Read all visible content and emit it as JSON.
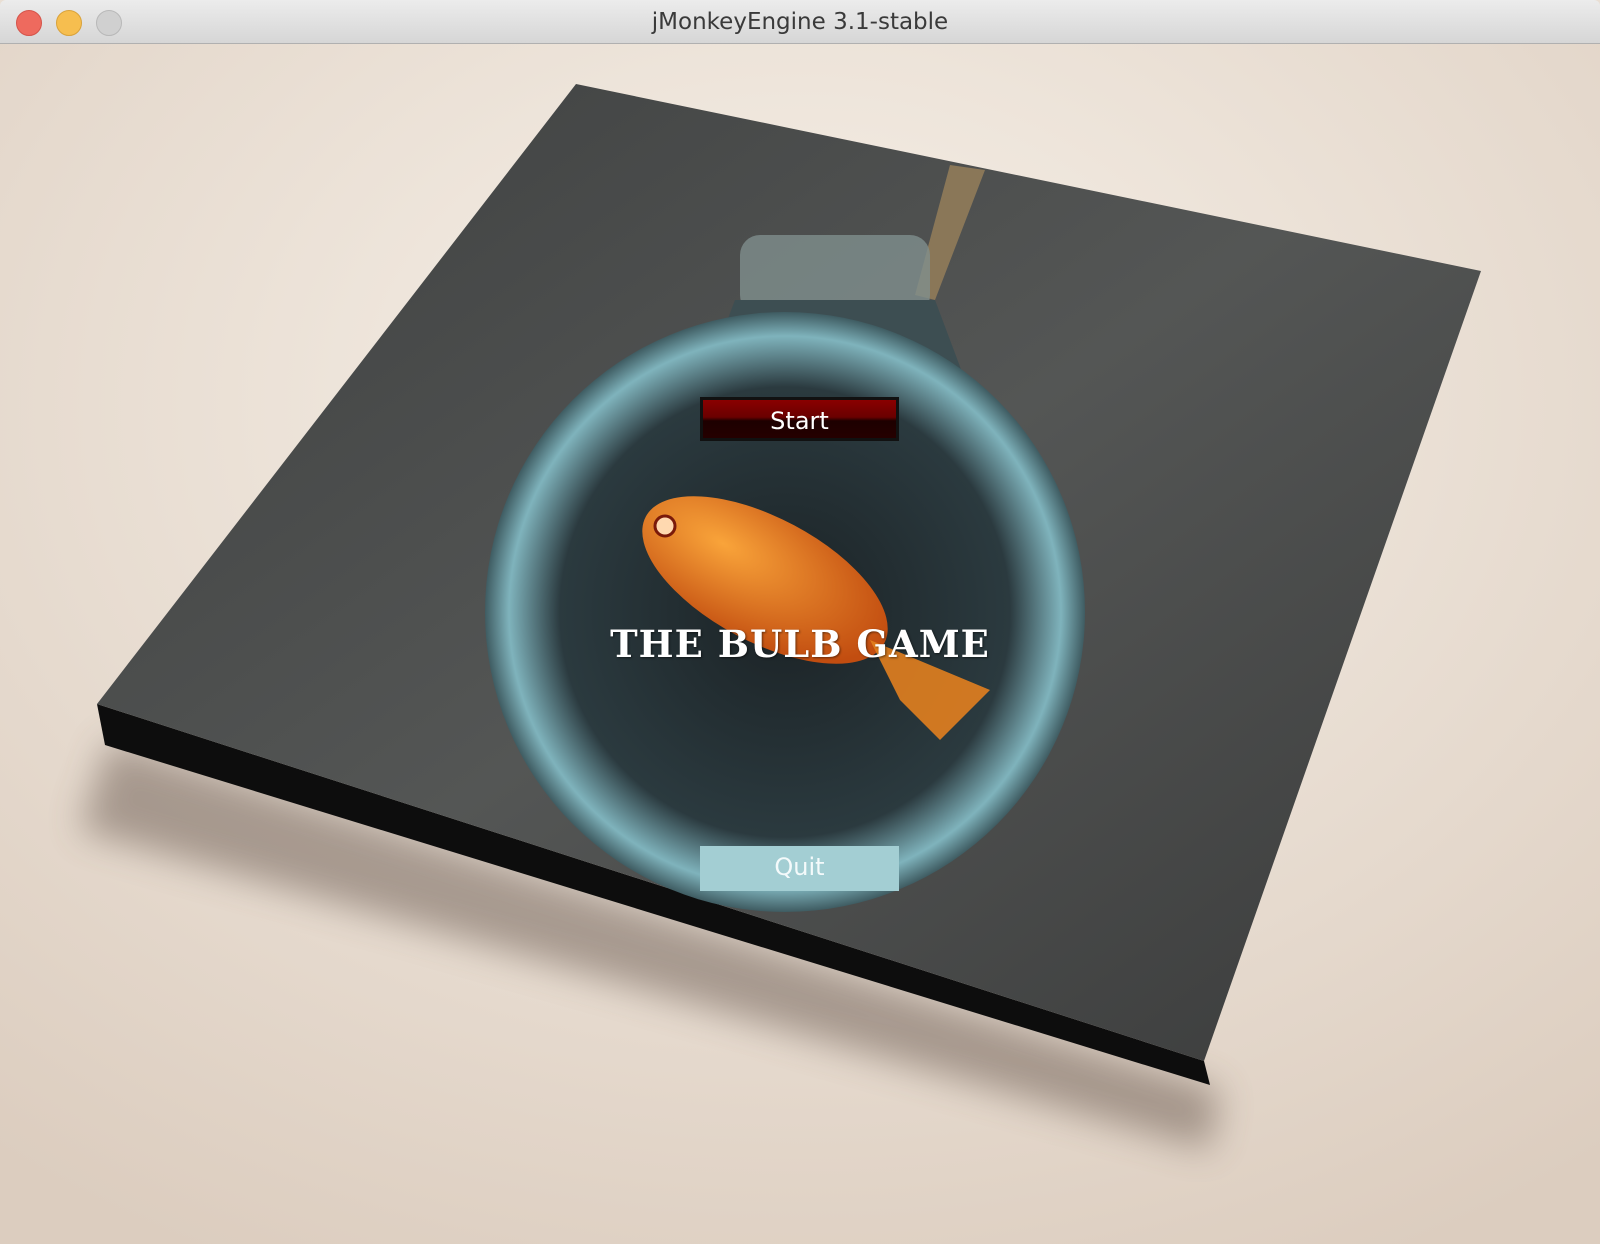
{
  "window": {
    "title": "jMonkeyEngine 3.1-stable",
    "controls": [
      "close",
      "minimize",
      "zoom"
    ],
    "colors": {
      "close": "#ee6a5e",
      "minimize": "#f6be4f",
      "zoom": "#d0d0d0"
    }
  },
  "menu": {
    "start_label": "Start",
    "title": "THE BULB GAME",
    "quit_label": "Quit",
    "colors": {
      "start": "#7a0000",
      "quit": "#a3ced3"
    }
  }
}
